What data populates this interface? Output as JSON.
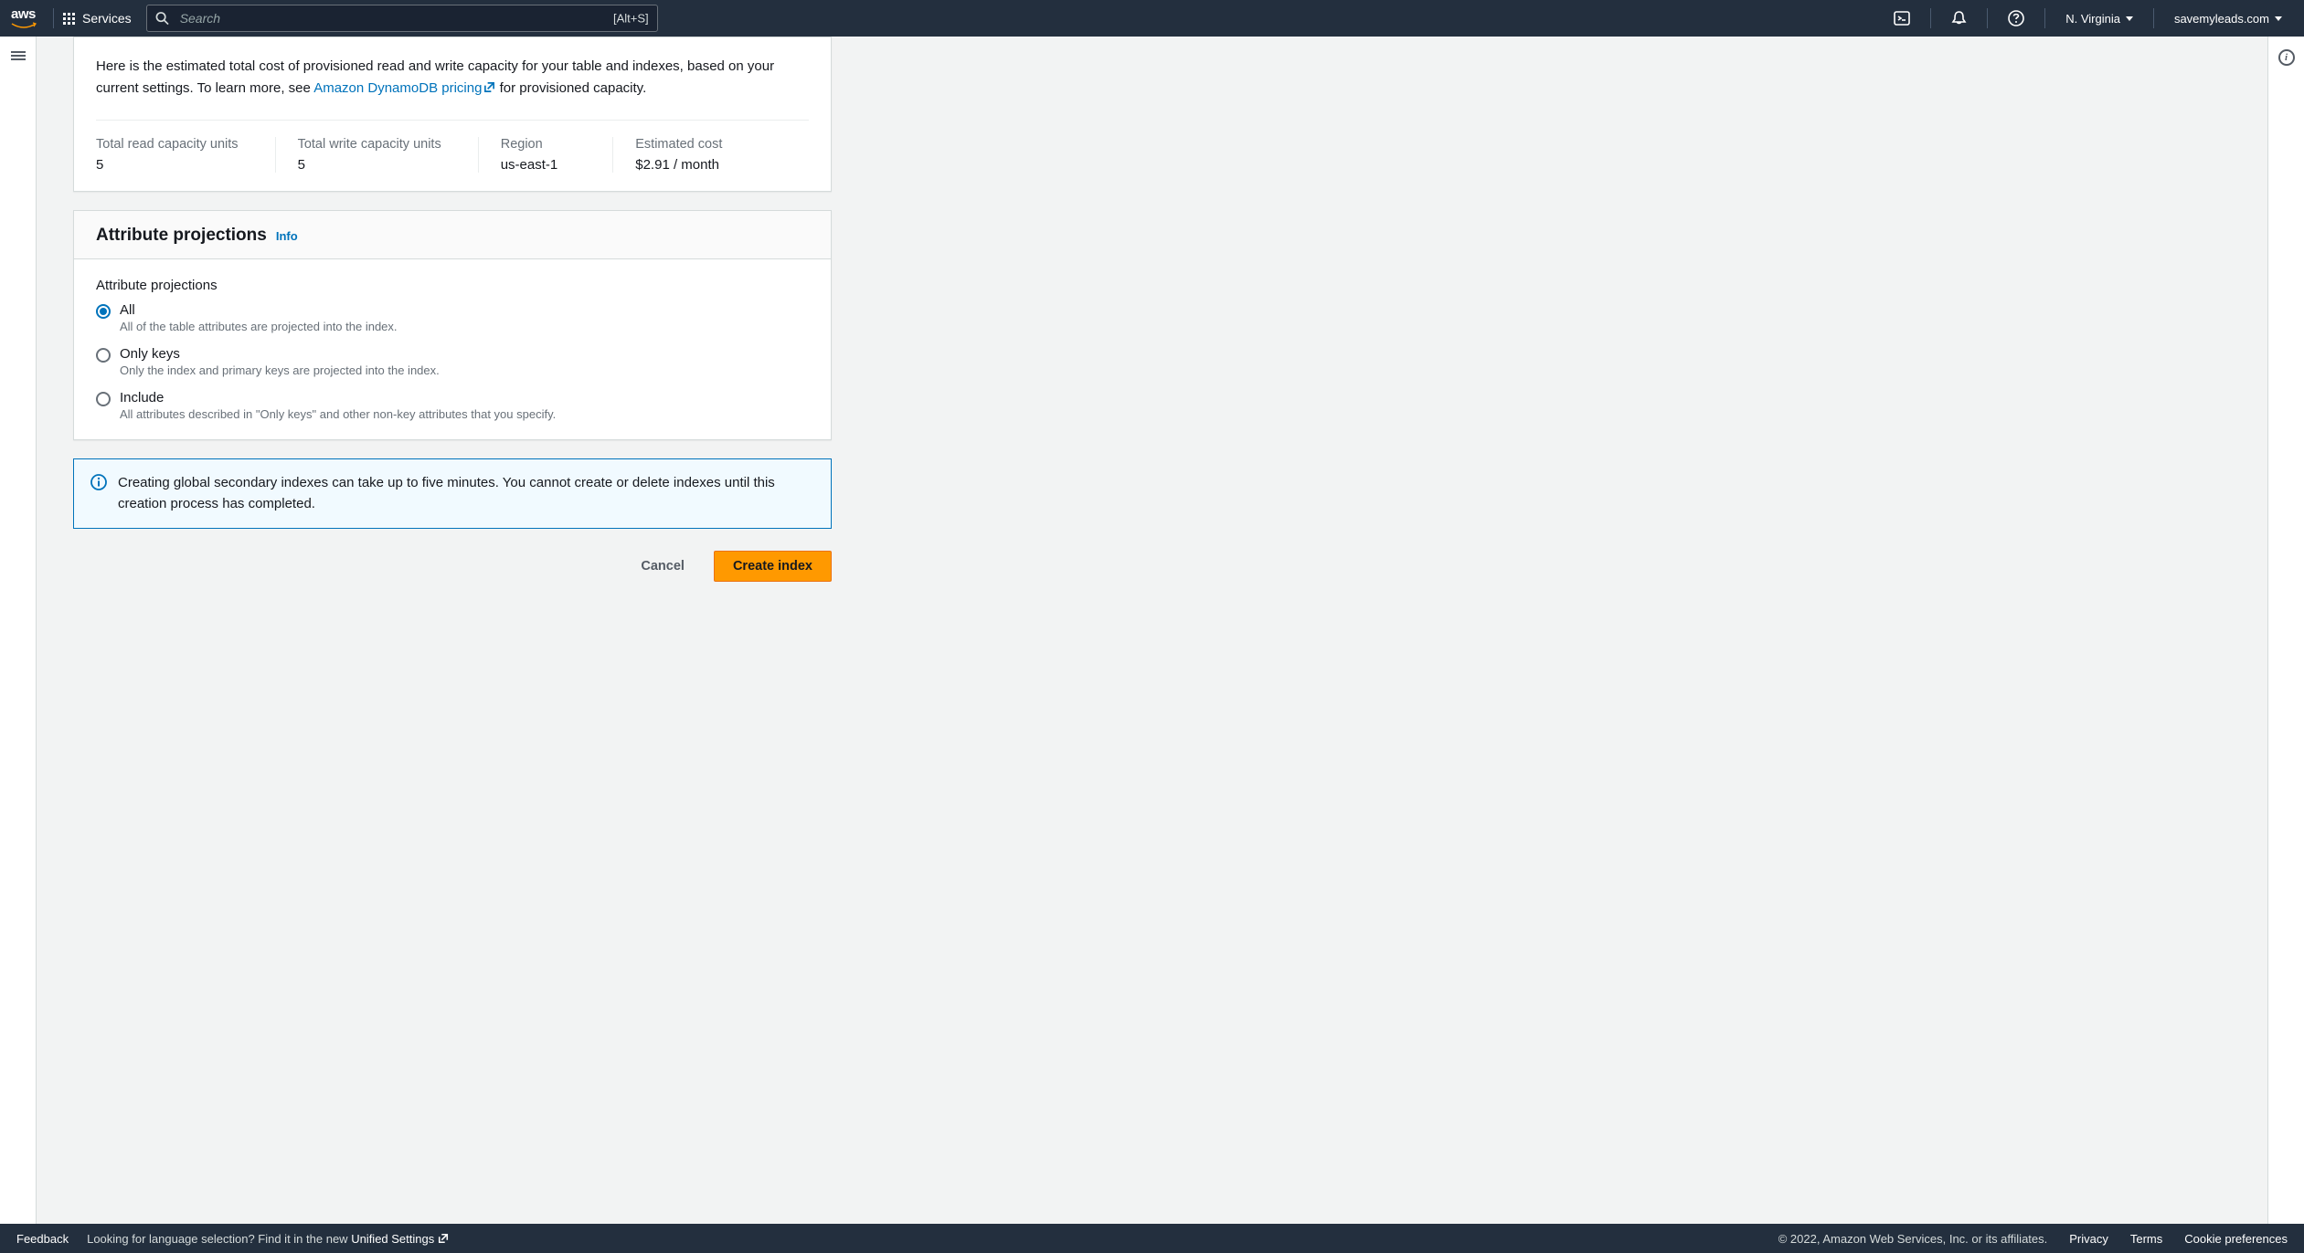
{
  "header": {
    "logo": "aws",
    "services_label": "Services",
    "search_placeholder": "Search",
    "search_shortcut": "[Alt+S]",
    "region": "N. Virginia",
    "account": "savemyleads.com"
  },
  "cost_panel": {
    "description_prefix": "Here is the estimated total cost of provisioned read and write capacity for your table and indexes, based on your current settings. To learn more, see ",
    "pricing_link": "Amazon DynamoDB pricing",
    "description_suffix": " for provisioned capacity.",
    "metrics": {
      "read_label": "Total read capacity units",
      "read_value": "5",
      "write_label": "Total write capacity units",
      "write_value": "5",
      "region_label": "Region",
      "region_value": "us-east-1",
      "cost_label": "Estimated cost",
      "cost_value": "$2.91 / month"
    }
  },
  "projections_panel": {
    "title": "Attribute projections",
    "info_label": "Info",
    "field_label": "Attribute projections",
    "options": {
      "all": {
        "label": "All",
        "desc": "All of the table attributes are projected into the index."
      },
      "keys": {
        "label": "Only keys",
        "desc": "Only the index and primary keys are projected into the index."
      },
      "include": {
        "label": "Include",
        "desc": "All attributes described in \"Only keys\" and other non-key attributes that you specify."
      }
    }
  },
  "alert": {
    "text": "Creating global secondary indexes can take up to five minutes. You cannot create or delete indexes until this creation process has completed."
  },
  "actions": {
    "cancel": "Cancel",
    "create": "Create index"
  },
  "footer": {
    "feedback": "Feedback",
    "lang_prefix": "Looking for language selection? Find it in the new ",
    "unified_link": "Unified Settings",
    "copyright": "© 2022, Amazon Web Services, Inc. or its affiliates.",
    "privacy": "Privacy",
    "terms": "Terms",
    "cookies": "Cookie preferences"
  }
}
